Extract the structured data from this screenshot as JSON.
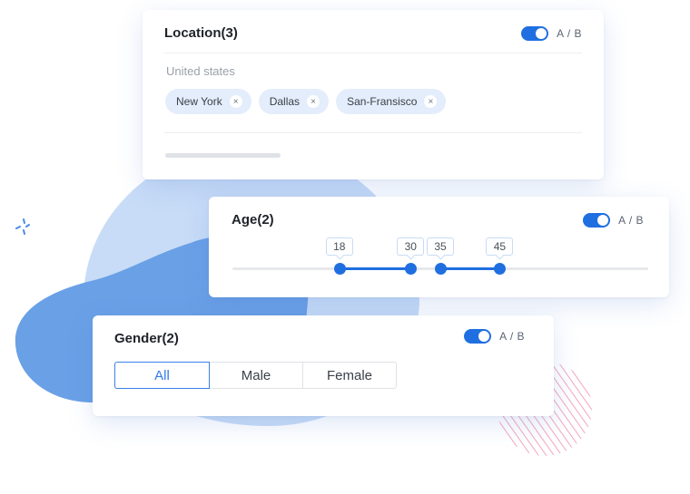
{
  "colors": {
    "accent": "#1f6fe0",
    "chip_bg": "#e4edfb",
    "blob_light": "#c8dcf7",
    "blob_dark": "#6aa0e6",
    "hatch": "#f3a6bd"
  },
  "location": {
    "title": "Location(3)",
    "ab_enabled": true,
    "ab_label": "A / B",
    "country": "United states",
    "chips": [
      {
        "label": "New York",
        "remove_icon": "×"
      },
      {
        "label": "Dallas",
        "remove_icon": "×"
      },
      {
        "label": "San-Fransisco",
        "remove_icon": "×"
      }
    ]
  },
  "age": {
    "title": "Age(2)",
    "ab_enabled": true,
    "ab_label": "A / B",
    "slider_min": 0,
    "slider_max": 70,
    "ranges": [
      {
        "from": 18,
        "to": 30,
        "from_label": "18",
        "to_label": "30"
      },
      {
        "from": 35,
        "to": 45,
        "from_label": "35",
        "to_label": "45"
      }
    ]
  },
  "gender": {
    "title": "Gender(2)",
    "ab_enabled": true,
    "ab_label": "A / B",
    "options": [
      "All",
      "Male",
      "Female"
    ],
    "selected": "All"
  },
  "icons": {
    "sparkle": "sparkle-icon",
    "remove": "close-icon"
  }
}
